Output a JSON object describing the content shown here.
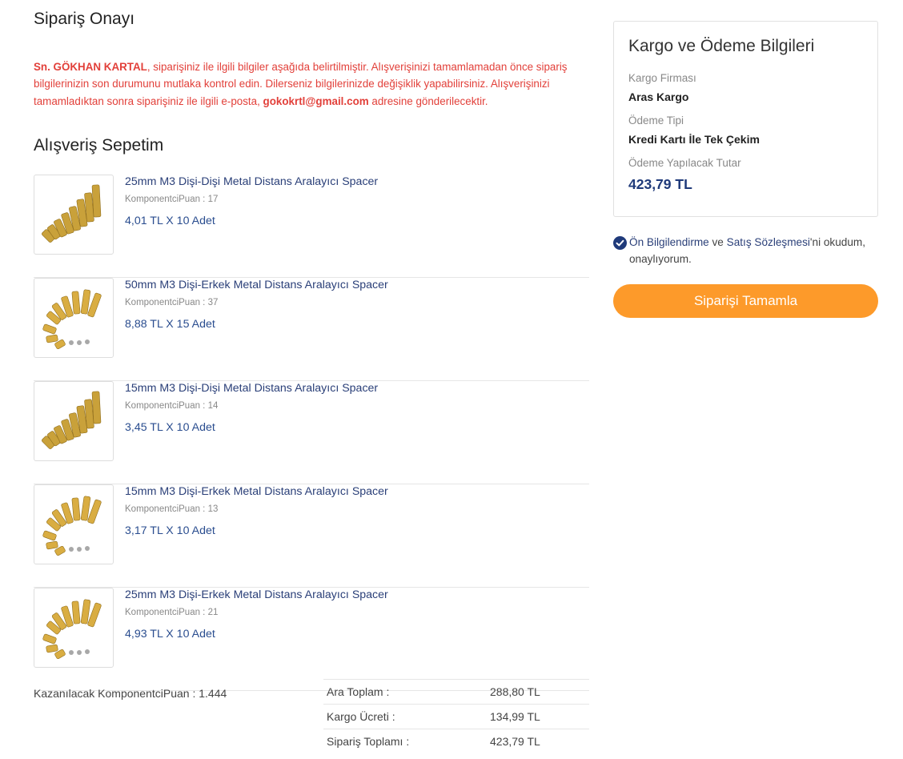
{
  "page": {
    "title": "Sipariş Onayı",
    "notice": {
      "customer_name": "Sn. GÖKHAN KARTAL",
      "text_1": ", siparişiniz ile ilgili bilgiler aşağıda belirtilmiştir. Alışverişinizi tamamlamadan önce sipariş bilgilerinizin son durumunu mutlaka kontrol edin. Dilerseniz bilgilerinizde değişiklik yapabilirsiniz. Alışverişinizi tamamladıktan sonra siparişiniz ile ilgili e-posta, ",
      "email": "gokokrtl@gmail.com",
      "text_2": " adresine gönderilecektir."
    },
    "cart_title": "Alışveriş Sepetim"
  },
  "cart": {
    "items": [
      {
        "name": "25mm M3 Dişi-Dişi Metal Distans Aralayıcı Spacer",
        "points": "KomponentciPuan : 17",
        "price": "4,01 TL X 10 Adet",
        "image": "brass-spacer-ff-icon"
      },
      {
        "name": "50mm M3 Dişi-Erkek Metal Distans Aralayıcı Spacer",
        "points": "KomponentciPuan : 37",
        "price": "8,88 TL X 15 Adet",
        "image": "brass-spacer-fm-icon"
      },
      {
        "name": "15mm M3 Dişi-Dişi Metal Distans Aralayıcı Spacer",
        "points": "KomponentciPuan : 14",
        "price": "3,45 TL X 10 Adet",
        "image": "brass-spacer-ff-icon"
      },
      {
        "name": "15mm M3 Dişi-Erkek Metal Distans Aralayıcı Spacer",
        "points": "KomponentciPuan : 13",
        "price": "3,17 TL X 10 Adet",
        "image": "brass-spacer-fm-icon"
      },
      {
        "name": "25mm M3 Dişi-Erkek Metal Distans Aralayıcı Spacer",
        "points": "KomponentciPuan : 21",
        "price": "4,93 TL X 10 Adet",
        "image": "brass-spacer-fm-icon"
      }
    ],
    "earned_points": "Kazanılacak KomponentciPuan : 1.444"
  },
  "totals": {
    "subtotal_label": "Ara Toplam :",
    "subtotal": "288,80 TL",
    "shipping_label": "Kargo Ücreti :",
    "shipping": "134,99 TL",
    "total_label": "Sipariş Toplamı :",
    "total": "423,79 TL"
  },
  "summary": {
    "title": "Kargo ve Ödeme Bilgileri",
    "carrier_label": "Kargo Firması",
    "carrier": "Aras Kargo",
    "payment_label": "Ödeme Tipi",
    "payment": "Kredi Kartı İle Tek Çekim",
    "amount_label": "Ödeme Yapılacak Tutar",
    "amount": "423,79 TL"
  },
  "agreement": {
    "link_1": "Ön Bilgilendirme",
    "between": " ve ",
    "link_2": "Satış Sözleşmesi",
    "suffix": "'ni okudum, onaylıyorum.",
    "checked": true
  },
  "actions": {
    "complete_label": "Siparişi Tamamla"
  },
  "colors": {
    "accent_orange": "#fd9a2a",
    "alert_red": "#e2403a",
    "navy": "#1f3a7a"
  }
}
